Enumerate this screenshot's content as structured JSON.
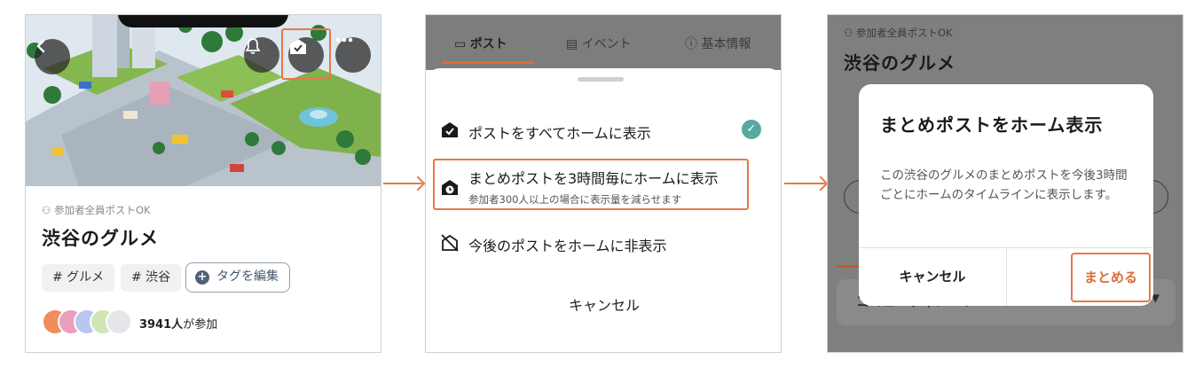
{
  "colors": {
    "accent": "#dd6c33",
    "highlight": "#e5794b",
    "check": "#58a99f"
  },
  "screen1": {
    "tag_note": "参加者全員ポストOK",
    "title": "渋谷のグルメ",
    "tags": [
      "# グルメ",
      "# 渋谷"
    ],
    "edit_tags_label": "タグを編集",
    "participants_count": "3941人",
    "participants_suffix": "が参加",
    "icons": [
      "back-icon",
      "bell-icon",
      "home-check-icon",
      "more-icon"
    ]
  },
  "screen2": {
    "tabs": [
      "ポスト",
      "イベント",
      "基本情報"
    ],
    "options": [
      {
        "label": "ポストをすべてホームに表示",
        "icon": "home-check-icon",
        "selected": true
      },
      {
        "label": "まとめポストを3時間毎にホームに表示",
        "sub": "参加者300人以上の場合に表示量を減らせます",
        "icon": "home-clock-icon"
      },
      {
        "label": "今後のポストをホームに非表示",
        "icon": "home-off-icon"
      }
    ],
    "cancel_label": "キャンセル"
  },
  "screen3": {
    "bg_note": "参加者全員ポストOK",
    "bg_title": "渋谷のグルメ",
    "dialog_title": "まとめポストをホーム表示",
    "dialog_body": "この渋谷のグルメのまとめポストを今後3時間ごとにホームのタイムラインに表示します。",
    "cancel_label": "キャンセル",
    "confirm_label": "まとめる",
    "bg_row_label": "コミュニティノート"
  }
}
